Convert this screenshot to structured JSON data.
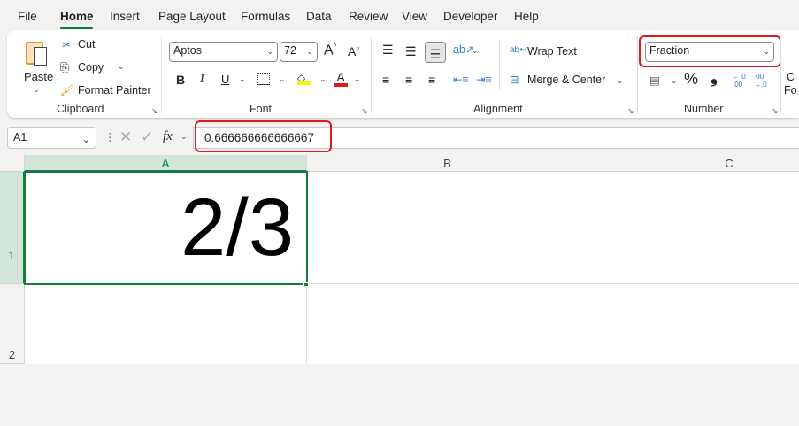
{
  "menu": {
    "tabs": [
      "File",
      "Home",
      "Insert",
      "Page Layout",
      "Formulas",
      "Data",
      "Review",
      "View",
      "Developer",
      "Help"
    ],
    "active": "Home"
  },
  "clipboard": {
    "paste": "Paste",
    "cut": "Cut",
    "copy": "Copy",
    "format_painter": "Format Painter",
    "group": "Clipboard"
  },
  "font": {
    "name": "Aptos",
    "size": "72",
    "bold": "B",
    "italic": "I",
    "underline": "U",
    "group": "Font"
  },
  "alignment": {
    "wrap_text": "Wrap Text",
    "merge_center": "Merge & Center",
    "group": "Alignment"
  },
  "number": {
    "format": "Fraction",
    "percent": "%",
    "comma": "❟",
    "inc_decimal": "←.0 .00",
    "dec_decimal": ".00 →.0",
    "group": "Number"
  },
  "cut_off": {
    "line1": "C",
    "line2": "Fo"
  },
  "formula_bar": {
    "name_box": "A1",
    "fx": "fx",
    "value": "0.666666666666667"
  },
  "sheet": {
    "columns": [
      "A",
      "B",
      "C"
    ],
    "rows": [
      "1",
      "2"
    ],
    "cells": {
      "A1": "2/3"
    }
  },
  "colors": {
    "accent": "#107c41",
    "highlight": "#e0191f"
  }
}
